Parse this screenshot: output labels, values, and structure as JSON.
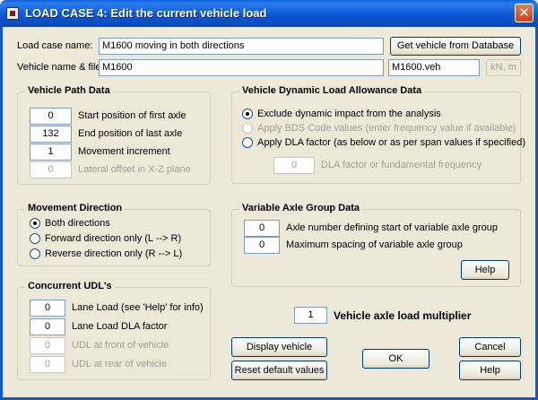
{
  "window": {
    "title": "LOAD CASE   4:  Edit the current vehicle load",
    "close": "✕"
  },
  "load_case": {
    "name_label": "Load case name:",
    "name_value": "M1600 moving in both directions",
    "vehicle_label": "Vehicle name & file:",
    "vehicle_value": "M1600",
    "file_value": "M1600.veh",
    "units_label": "kN, m",
    "get_vehicle_button": "Get vehicle from Database"
  },
  "path": {
    "title": "Vehicle Path Data",
    "rows": [
      {
        "value": "0",
        "label": "Start position of first axle"
      },
      {
        "value": "132",
        "label": "End position of last axle"
      },
      {
        "value": "1",
        "label": "Movement increment"
      },
      {
        "value": "0",
        "label": "Lateral offset in X-Z plane"
      }
    ]
  },
  "dla": {
    "title": "Vehicle Dynamic Load Allowance Data",
    "options": [
      "Exclude dynamic impact from the analysis",
      "Apply BDS Code values  (enter frequency value if available)",
      "Apply DLA factor (as below or as per span values if specified)"
    ],
    "factor_value": "0",
    "factor_label": "DLA factor or fundamental frequency"
  },
  "movement": {
    "title": "Movement Direction",
    "options": [
      "Both directions",
      "Forward direction only    (L --> R)",
      "Reverse direction only    (R --> L)"
    ]
  },
  "axle_group": {
    "title": "Variable Axle Group Data",
    "rows": [
      {
        "value": "0",
        "label": "Axle number defining start of variable axle group"
      },
      {
        "value": "0",
        "label": "Maximum spacing of variable axle group"
      }
    ],
    "help_button": "Help"
  },
  "udl": {
    "title": "Concurrent UDL's",
    "rows": [
      {
        "value": "0",
        "label": "Lane Load  (see 'Help' for info)"
      },
      {
        "value": "0",
        "label": "Lane Load DLA factor"
      },
      {
        "value": "0",
        "label": "UDL at front of vehicle"
      },
      {
        "value": "0",
        "label": "UDL at rear of vehicle"
      }
    ]
  },
  "multiplier": {
    "value": "1",
    "label": "Vehicle axle load multiplier"
  },
  "buttons": {
    "display": "Display vehicle",
    "reset": "Reset default values",
    "ok": "OK",
    "cancel": "Cancel",
    "help": "Help"
  }
}
